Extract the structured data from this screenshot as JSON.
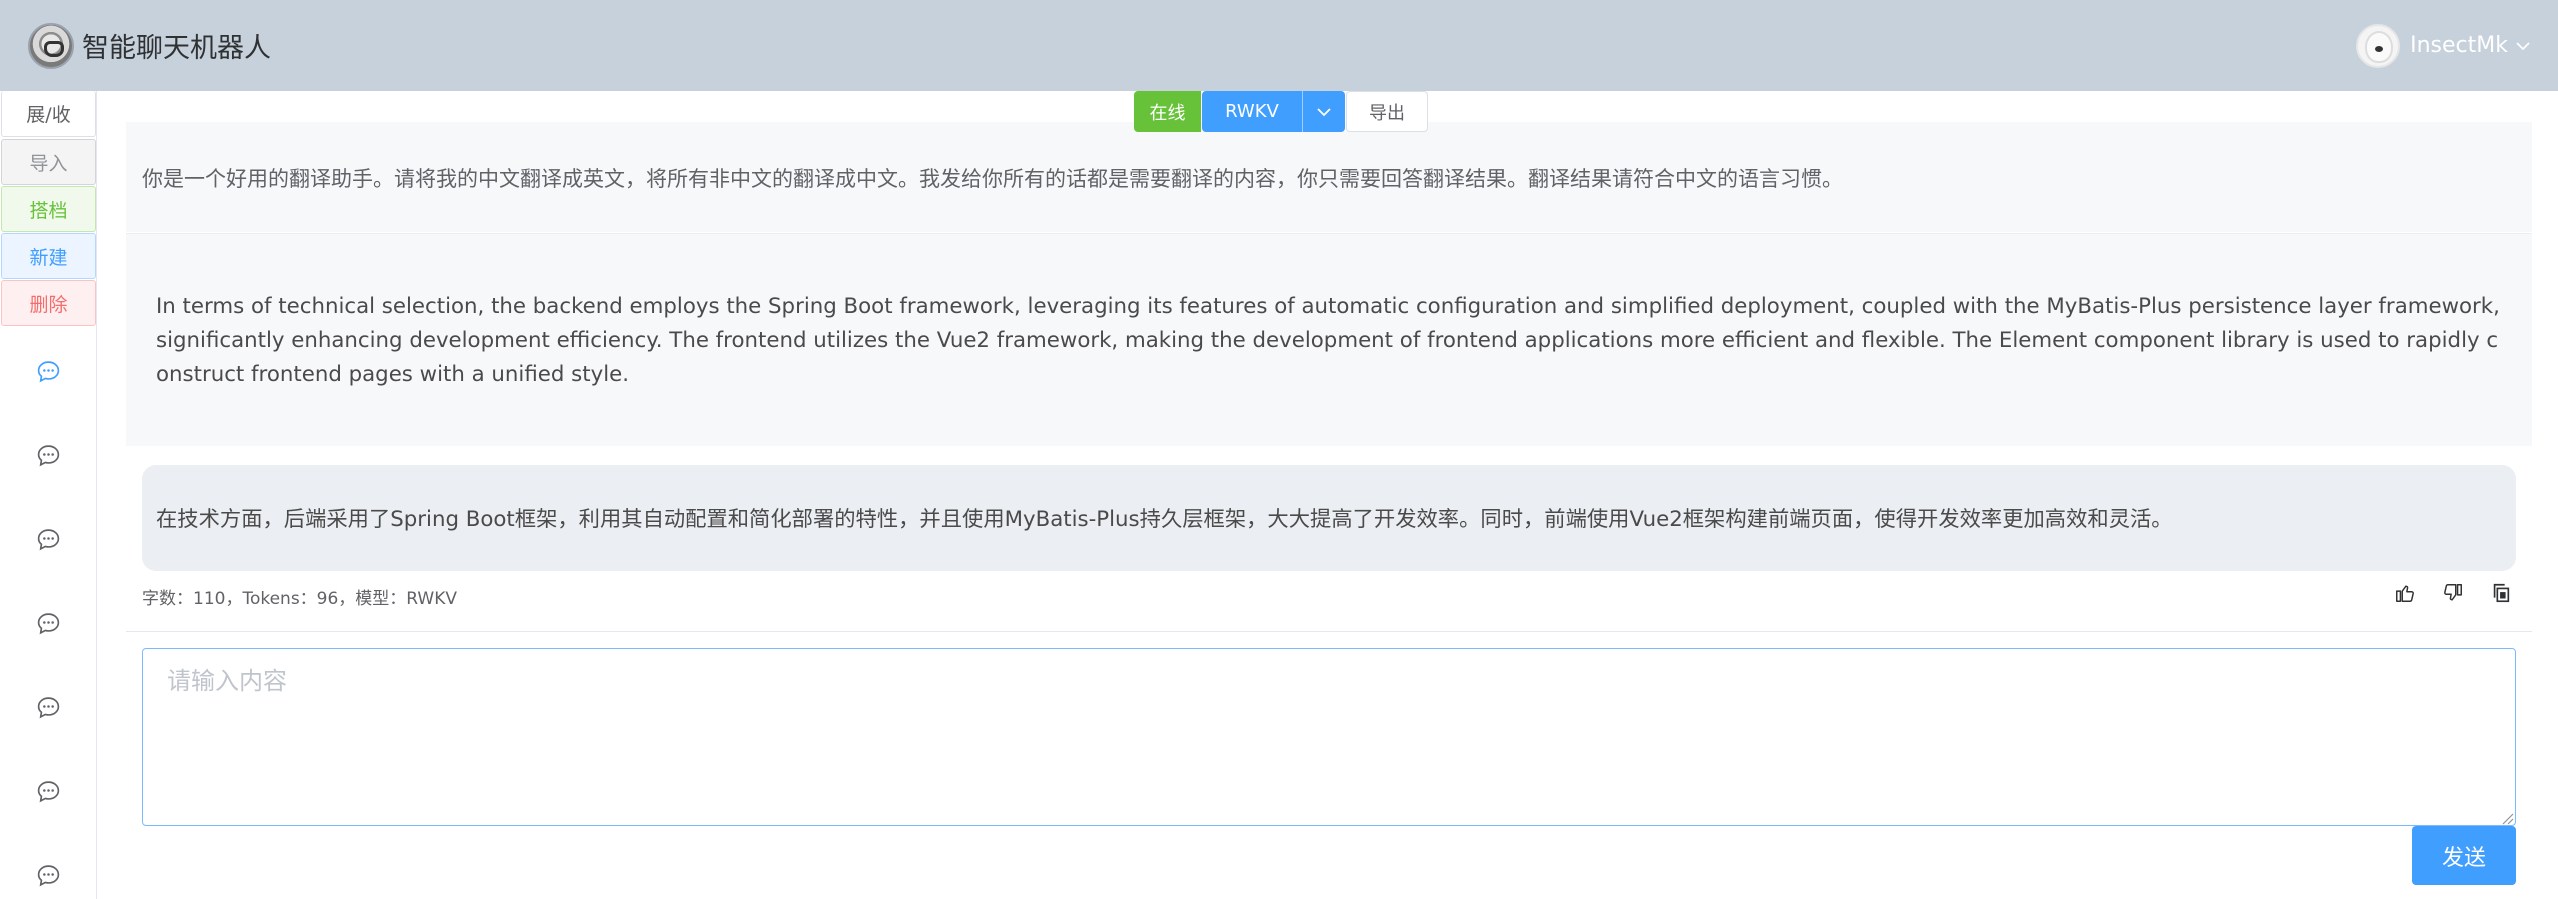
{
  "header": {
    "title": "智能聊天机器人",
    "username": "InsectMk",
    "user_menu_icon": "chevron-down-icon"
  },
  "sidebar": {
    "toggle_label": "展/收",
    "import_label": "导入",
    "archive_label": "搭档",
    "new_label": "新建",
    "delete_label": "删除",
    "chat_items_count_shown": 7
  },
  "toolbar": {
    "status_label": "在线",
    "model_label": "RWKV",
    "export_label": "导出"
  },
  "conversation": {
    "system_prompt": "你是一个好用的翻译助手。请将我的中文翻译成英文，将所有非中文的翻译成中文。我发给你所有的话都是需要翻译的内容，你只需要回答翻译结果。翻译结果请符合中文的语言习惯。",
    "user_message": "In terms of technical selection, the backend employs the Spring Boot framework, leveraging its features of automatic configuration and simplified deployment, coupled with the MyBatis-Plus persistence layer framework, significantly enhancing development efficiency. The frontend utilizes the Vue2 framework, making the development of frontend applications more efficient and flexible. The Element component library is used to rapidly construct frontend pages with a unified style.",
    "bot_message": "在技术方面，后端采用了Spring Boot框架，利用其自动配置和简化部署的特性，并且使用MyBatis-Plus持久层框架，大大提高了开发效率。同时，前端使用Vue2框架构建前端页面，使得开发效率更加高效和灵活。",
    "meta": "字数：110，Tokens：96，模型：RWKV"
  },
  "input": {
    "placeholder": "请输入内容",
    "value": "",
    "send_label": "发送"
  },
  "colors": {
    "header_bg": "#c6d1dc",
    "primary": "#409eff",
    "success": "#67c23a",
    "danger": "#f56c6c"
  }
}
